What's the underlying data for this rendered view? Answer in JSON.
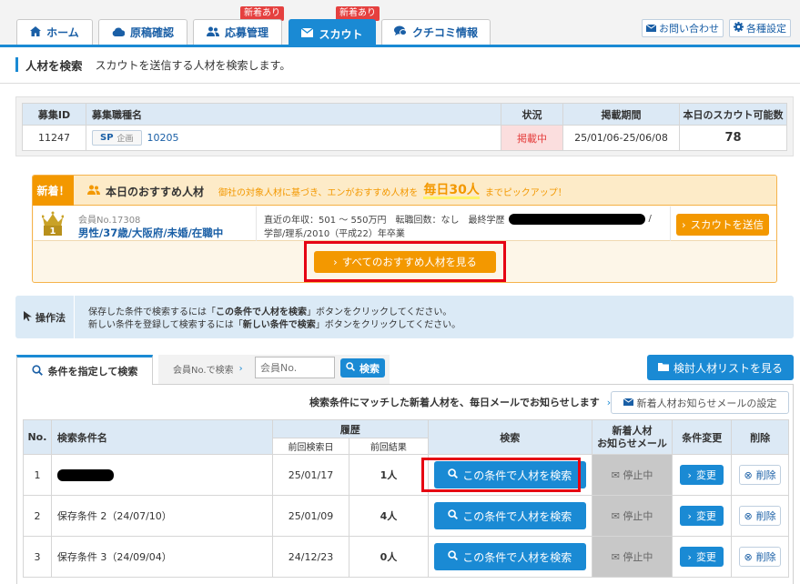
{
  "nav": {
    "tabs": [
      {
        "label": "ホーム",
        "icon": "home-icon"
      },
      {
        "label": "原稿確認",
        "icon": "cloud-icon"
      },
      {
        "label": "応募管理",
        "icon": "users-icon",
        "badge": "新着あり"
      },
      {
        "label": "スカウト",
        "icon": "mail-icon",
        "badge": "新着あり",
        "active": true
      },
      {
        "label": "クチコミ情報",
        "icon": "chat-icon"
      }
    ],
    "contact": "お問い合わせ",
    "settings": "各種設定"
  },
  "page": {
    "title": "人材を検索",
    "description": "スカウトを送信する人材を検索します。"
  },
  "job_table": {
    "headers": [
      "募集ID",
      "募集職種名",
      "状況",
      "掲載期間",
      "本日のスカウト可能数"
    ],
    "row": {
      "id": "11247",
      "sp_tag": "SP",
      "plan_tag": "企画",
      "job_name": "10205",
      "status": "掲載中",
      "period": "25/01/06-25/06/08",
      "scout_count": "78"
    }
  },
  "recommend": {
    "new_tag": "新着！",
    "title": "本日のおすすめ人材",
    "desc_pre": "御社の対象人材に基づき、エンがおすすめ人材を",
    "highlight": "毎日30人",
    "desc_post": "までピックアップ！",
    "candidate": {
      "rank": "1",
      "member_no": "会員No.17308",
      "profile": "男性/37歳/大阪府/未婚/在職中",
      "line1": "直近の年収：501 ～ 550万円　転職回数：なし　最終学歴",
      "line1_tail": "/",
      "line2": "学部/理系/2010（平成22）年卒業"
    },
    "scout_button": "スカウトを送信",
    "all_button": "すべてのおすすめ人材を見る"
  },
  "howto": {
    "label": "操作法",
    "line1_a": "保存した条件で検索するには「",
    "line1_b": "この条件で人材を検索",
    "line1_c": "」ボタンをクリックしてください。",
    "line2_a": "新しい条件を登録して検索するには「",
    "line2_b": "新しい条件で検索",
    "line2_c": "」ボタンをクリックしてください。"
  },
  "search": {
    "tab_label": "条件を指定して検索",
    "member_search_label": "会員No.で検索",
    "member_placeholder": "会員No.",
    "search_button": "検索",
    "review_list_button": "検討人材リストを見る",
    "notice_text": "検索条件にマッチした新着人材を、毎日メールでお知らせします",
    "notice_button": "新着人材お知らせメールの設定"
  },
  "conditions": {
    "headers": {
      "no": "No.",
      "name": "検索条件名",
      "history": "履歴",
      "last_date": "前回検索日",
      "last_result": "前回結果",
      "search": "検索",
      "mail": "新着人材\nお知らせメール",
      "change": "条件変更",
      "delete": "削除"
    },
    "rows": [
      {
        "no": "1",
        "name": "",
        "date": "25/01/17",
        "result": "1人",
        "search_btn": "この条件で人材を検索",
        "mail": "停止中",
        "change": "変更",
        "delete": "削除"
      },
      {
        "no": "2",
        "name": "保存条件 2（24/07/10）",
        "date": "25/01/09",
        "result": "4人",
        "search_btn": "この条件で人材を検索",
        "mail": "停止中",
        "change": "変更",
        "delete": "削除"
      },
      {
        "no": "3",
        "name": "保存条件 3（24/09/04）",
        "date": "24/12/23",
        "result": "0人",
        "search_btn": "この条件で人材を検索",
        "mail": "停止中",
        "change": "変更",
        "delete": "削除"
      }
    ]
  },
  "colors": {
    "primary": "#1a8ad4",
    "orange": "#f39800",
    "highlight_red": "#e60012",
    "status_bg": "#fbdede"
  }
}
